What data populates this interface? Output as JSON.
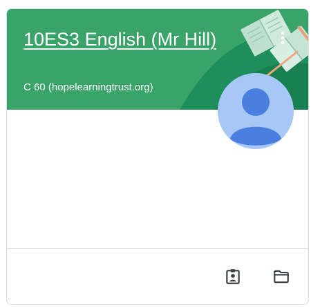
{
  "class_card": {
    "title": "10ES3 English (Mr Hill)",
    "subtitle": "C 60 (hopelearningtrust.org)",
    "header_color": "#3aa36a",
    "header_illustration": "open-books",
    "more_icon": "more-vert-icon",
    "avatar_icon": "account-circle-icon",
    "footer_actions": [
      {
        "icon": "assignment-ind-icon"
      },
      {
        "icon": "folder-icon"
      }
    ]
  }
}
